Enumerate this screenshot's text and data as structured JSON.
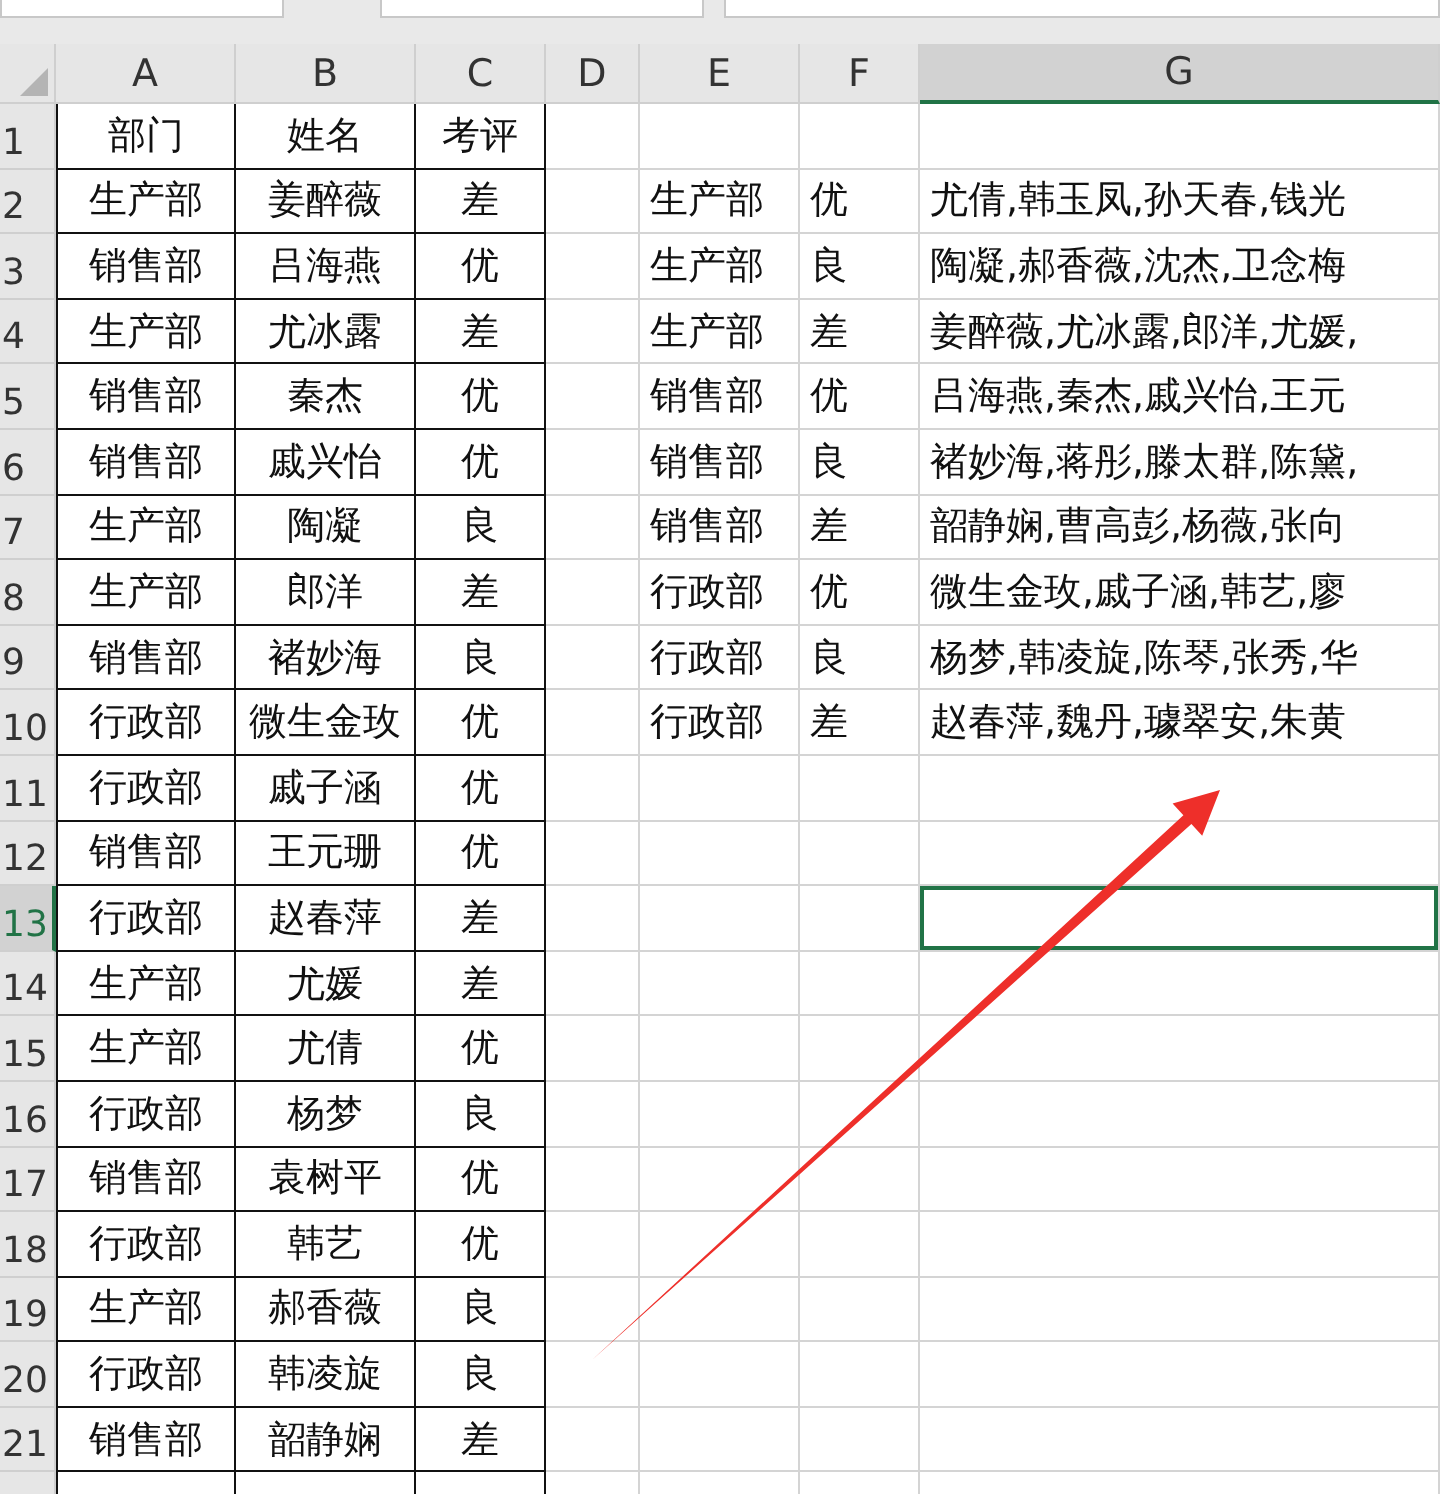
{
  "columns": [
    {
      "label": "A",
      "selected": false
    },
    {
      "label": "B",
      "selected": false
    },
    {
      "label": "C",
      "selected": false
    },
    {
      "label": "D",
      "selected": false
    },
    {
      "label": "E",
      "selected": false
    },
    {
      "label": "F",
      "selected": false
    },
    {
      "label": "G",
      "selected": true
    }
  ],
  "rows": [
    {
      "header": "1",
      "selected": false,
      "table": [
        "部门",
        "姓名",
        "考评"
      ]
    },
    {
      "header": "2",
      "selected": false,
      "table": [
        "生产部",
        "姜醉薇",
        "差"
      ],
      "summary": [
        "生产部",
        "优",
        "尤倩,韩玉凤,孙天春,钱光"
      ]
    },
    {
      "header": "3",
      "selected": false,
      "table": [
        "销售部",
        "吕海燕",
        "优"
      ],
      "summary": [
        "生产部",
        "良",
        "陶凝,郝香薇,沈杰,卫念梅"
      ]
    },
    {
      "header": "4",
      "selected": false,
      "table": [
        "生产部",
        "尤冰露",
        "差"
      ],
      "summary": [
        "生产部",
        "差",
        "姜醉薇,尤冰露,郎洋,尤媛,"
      ]
    },
    {
      "header": "5",
      "selected": false,
      "table": [
        "销售部",
        "秦杰",
        "优"
      ],
      "summary": [
        "销售部",
        "优",
        "吕海燕,秦杰,戚兴怡,王元"
      ]
    },
    {
      "header": "6",
      "selected": false,
      "table": [
        "销售部",
        "戚兴怡",
        "优"
      ],
      "summary": [
        "销售部",
        "良",
        "褚妙海,蒋彤,滕太群,陈黛,"
      ]
    },
    {
      "header": "7",
      "selected": false,
      "table": [
        "生产部",
        "陶凝",
        "良"
      ],
      "summary": [
        "销售部",
        "差",
        "韶静娴,曹高彭,杨薇,张向"
      ]
    },
    {
      "header": "8",
      "selected": false,
      "table": [
        "生产部",
        "郎洋",
        "差"
      ],
      "summary": [
        "行政部",
        "优",
        "微生金玫,戚子涵,韩艺,廖"
      ]
    },
    {
      "header": "9",
      "selected": false,
      "table": [
        "销售部",
        "褚妙海",
        "良"
      ],
      "summary": [
        "行政部",
        "良",
        "杨梦,韩凌旋,陈琴,张秀,华"
      ]
    },
    {
      "header": "10",
      "selected": false,
      "table": [
        "行政部",
        "微生金玫",
        "优"
      ],
      "summary": [
        "行政部",
        "差",
        "赵春萍,魏丹,璩翠安,朱黄"
      ]
    },
    {
      "header": "11",
      "selected": false,
      "table": [
        "行政部",
        "戚子涵",
        "优"
      ]
    },
    {
      "header": "12",
      "selected": false,
      "table": [
        "销售部",
        "王元珊",
        "优"
      ]
    },
    {
      "header": "13",
      "selected": true,
      "table": [
        "行政部",
        "赵春萍",
        "差"
      ]
    },
    {
      "header": "14",
      "selected": false,
      "table": [
        "生产部",
        "尤媛",
        "差"
      ]
    },
    {
      "header": "15",
      "selected": false,
      "table": [
        "生产部",
        "尤倩",
        "优"
      ]
    },
    {
      "header": "16",
      "selected": false,
      "table": [
        "行政部",
        "杨梦",
        "良"
      ]
    },
    {
      "header": "17",
      "selected": false,
      "table": [
        "销售部",
        "袁树平",
        "优"
      ]
    },
    {
      "header": "18",
      "selected": false,
      "table": [
        "行政部",
        "韩艺",
        "优"
      ]
    },
    {
      "header": "19",
      "selected": false,
      "table": [
        "生产部",
        "郝香薇",
        "良"
      ]
    },
    {
      "header": "20",
      "selected": false,
      "table": [
        "行政部",
        "韩凌旋",
        "良"
      ]
    },
    {
      "header": "21",
      "selected": false,
      "table": [
        "销售部",
        "韶静娴",
        "差"
      ]
    }
  ]
}
